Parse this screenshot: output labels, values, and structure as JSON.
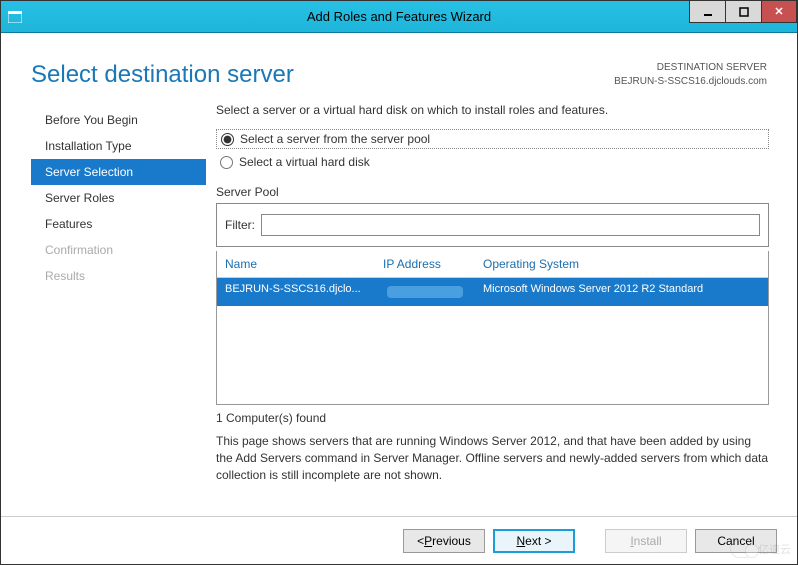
{
  "window": {
    "title": "Add Roles and Features Wizard"
  },
  "header": {
    "page_title": "Select destination server",
    "dest_label": "DESTINATION SERVER",
    "dest_value": "BEJRUN-S-SSCS16.djclouds.com"
  },
  "nav": {
    "items": [
      {
        "label": "Before You Begin",
        "state": "normal"
      },
      {
        "label": "Installation Type",
        "state": "normal"
      },
      {
        "label": "Server Selection",
        "state": "active"
      },
      {
        "label": "Server Roles",
        "state": "normal"
      },
      {
        "label": "Features",
        "state": "normal"
      },
      {
        "label": "Confirmation",
        "state": "disabled"
      },
      {
        "label": "Results",
        "state": "disabled"
      }
    ]
  },
  "content": {
    "instruction": "Select a server or a virtual hard disk on which to install roles and features.",
    "radio_pool": "Select a server from the server pool",
    "radio_vhd": "Select a virtual hard disk",
    "section_label": "Server Pool",
    "filter_label": "Filter:",
    "filter_value": "",
    "columns": {
      "name": "Name",
      "ip": "IP Address",
      "os": "Operating System"
    },
    "rows": [
      {
        "name": "BEJRUN-S-SSCS16.djclo...",
        "ip": "",
        "os": "Microsoft Windows Server 2012 R2 Standard"
      }
    ],
    "found_text": "1 Computer(s) found",
    "description": "This page shows servers that are running Windows Server 2012, and that have been added by using the Add Servers command in Server Manager. Offline servers and newly-added servers from which data collection is still incomplete are not shown."
  },
  "footer": {
    "previous": "Previous",
    "next": "Next >",
    "install": "Install",
    "cancel": "Cancel"
  },
  "watermark": "亿速云"
}
